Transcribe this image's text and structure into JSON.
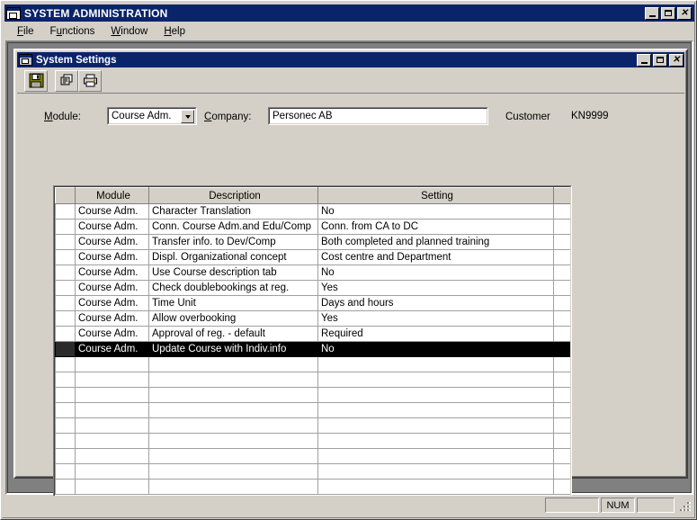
{
  "main_window": {
    "title": "SYSTEM ADMINISTRATION",
    "icon": "window-icon",
    "buttons": {
      "minimize": "_",
      "maximize": "□",
      "close": "✕"
    }
  },
  "menu": {
    "items": [
      {
        "label": "File",
        "accel": "F"
      },
      {
        "label": "Functions",
        "accel": "F"
      },
      {
        "label": "Window",
        "accel": "W"
      },
      {
        "label": "Help",
        "accel": "H"
      }
    ]
  },
  "child_window": {
    "title": "System Settings",
    "icon": "window-icon",
    "buttons": {
      "minimize": "_",
      "maximize": "□",
      "close": "✕"
    },
    "toolbar": [
      {
        "name": "save-button",
        "icon": "floppy-disk-icon"
      },
      {
        "name": "copy-button",
        "icon": "copy-icon"
      },
      {
        "name": "print-button",
        "icon": "printer-icon"
      }
    ],
    "form": {
      "module_label": "Module:",
      "module_accel": "M",
      "module_value": "Course Adm.",
      "company_label": "Company:",
      "company_accel": "C",
      "company_value": "Personec AB",
      "customer_label": "Customer",
      "customer_value": "KN9999"
    },
    "grid": {
      "columns": [
        "",
        "Module",
        "Description",
        "Setting",
        ""
      ],
      "rows": [
        {
          "module": "Course Adm.",
          "description": "Character Translation",
          "setting": "No",
          "selected": false
        },
        {
          "module": "Course Adm.",
          "description": "Conn. Course Adm.and Edu/Comp",
          "setting": "Conn. from CA to DC",
          "selected": false
        },
        {
          "module": "Course Adm.",
          "description": "Transfer info. to Dev/Comp",
          "setting": "Both completed and planned training",
          "selected": false
        },
        {
          "module": "Course Adm.",
          "description": "Displ. Organizational concept",
          "setting": "Cost centre and Department",
          "selected": false
        },
        {
          "module": "Course Adm.",
          "description": "Use Course description tab",
          "setting": "No",
          "selected": false
        },
        {
          "module": "Course Adm.",
          "description": "Check doublebookings at reg.",
          "setting": "Yes",
          "selected": false
        },
        {
          "module": "Course Adm.",
          "description": "Time Unit",
          "setting": "Days and hours",
          "selected": false
        },
        {
          "module": "Course Adm.",
          "description": "Allow overbooking",
          "setting": "Yes",
          "selected": false
        },
        {
          "module": "Course Adm.",
          "description": "Approval of reg. - default",
          "setting": "Required",
          "selected": false
        },
        {
          "module": "Course Adm.",
          "description": "Update Course with Indiv.info",
          "setting": "No",
          "selected": true
        },
        {
          "module": "",
          "description": "",
          "setting": "",
          "selected": false
        },
        {
          "module": "",
          "description": "",
          "setting": "",
          "selected": false
        },
        {
          "module": "",
          "description": "",
          "setting": "",
          "selected": false
        },
        {
          "module": "",
          "description": "",
          "setting": "",
          "selected": false
        },
        {
          "module": "",
          "description": "",
          "setting": "",
          "selected": false
        },
        {
          "module": "",
          "description": "",
          "setting": "",
          "selected": false
        },
        {
          "module": "",
          "description": "",
          "setting": "",
          "selected": false
        },
        {
          "module": "",
          "description": "",
          "setting": "",
          "selected": false
        },
        {
          "module": "",
          "description": "",
          "setting": "",
          "selected": false
        }
      ]
    }
  },
  "status_bar": {
    "panel_left": "",
    "num_indicator": "NUM",
    "panel_right": ""
  },
  "colors": {
    "title_bar": "#0a246a",
    "face": "#d4d0c8",
    "mdi_background": "#808080",
    "selection": "#000000"
  }
}
